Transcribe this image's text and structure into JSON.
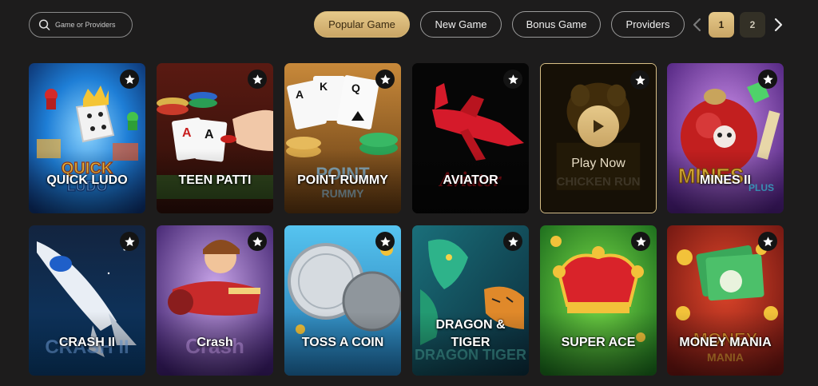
{
  "search": {
    "placeholder": "Game or Providers",
    "value": ""
  },
  "filters": [
    {
      "label": "Popular Game",
      "active": true
    },
    {
      "label": "New Game",
      "active": false
    },
    {
      "label": "Bonus Game",
      "active": false
    },
    {
      "label": "Providers",
      "active": false
    }
  ],
  "pagination": {
    "current": "1",
    "next": "2"
  },
  "hover_card": {
    "play_label": "Play Now"
  },
  "games": [
    {
      "title": "QUICK LUDO"
    },
    {
      "title": "TEEN PATTI"
    },
    {
      "title": "POINT RUMMY"
    },
    {
      "title": "AVIATOR"
    },
    {
      "title": "CHICKEN RUN"
    },
    {
      "title": "MINES II"
    },
    {
      "title": "CRASH II"
    },
    {
      "title": "Crash"
    },
    {
      "title": "TOSS A COIN"
    },
    {
      "title": "DRAGON & TIGER"
    },
    {
      "title": "SUPER ACE"
    },
    {
      "title": "MONEY MANIA"
    }
  ],
  "colors": {
    "background": "#1d1c1c",
    "accent_gold": "#d7b877",
    "star": "#ffffff"
  }
}
